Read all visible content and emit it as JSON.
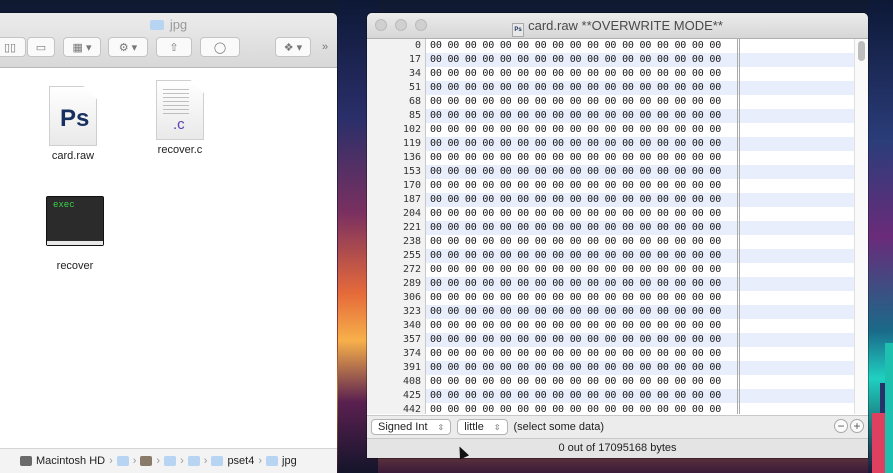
{
  "finder": {
    "title": "jpg",
    "toolbar": {
      "view_columns": "▯▯",
      "view_cover": "▭",
      "arrange": "▦ ▾",
      "action": "⚙ ▾",
      "share": "⇧",
      "tag": "◯",
      "dropbox": "❖ ▾",
      "more": "»"
    },
    "files": [
      {
        "name": "card.raw",
        "badge": "Ps"
      },
      {
        "name": "recover.c",
        "badge": ".c"
      },
      {
        "name": "recover",
        "badge": "exec"
      }
    ],
    "path": [
      "Macintosh HD",
      "",
      "",
      "",
      "",
      "pset4",
      "jpg"
    ]
  },
  "hex": {
    "title": "card.raw **OVERWRITE MODE**",
    "title_icon": "Ps",
    "offsets": [
      "0",
      "17",
      "34",
      "51",
      "68",
      "85",
      "102",
      "119",
      "136",
      "153",
      "170",
      "187",
      "204",
      "221",
      "238",
      "255",
      "272",
      "289",
      "306",
      "323",
      "340",
      "357",
      "374",
      "391",
      "408",
      "425",
      "442"
    ],
    "hex_line": "00 00 00 00 00 00 00 00 00 00 00 00 00 00 00 00 00",
    "type_select": "Signed Int",
    "endian_select": "little",
    "hint": "(select some data)",
    "status": "0 out of 17095168 bytes",
    "plus": "+",
    "minus": "−"
  }
}
